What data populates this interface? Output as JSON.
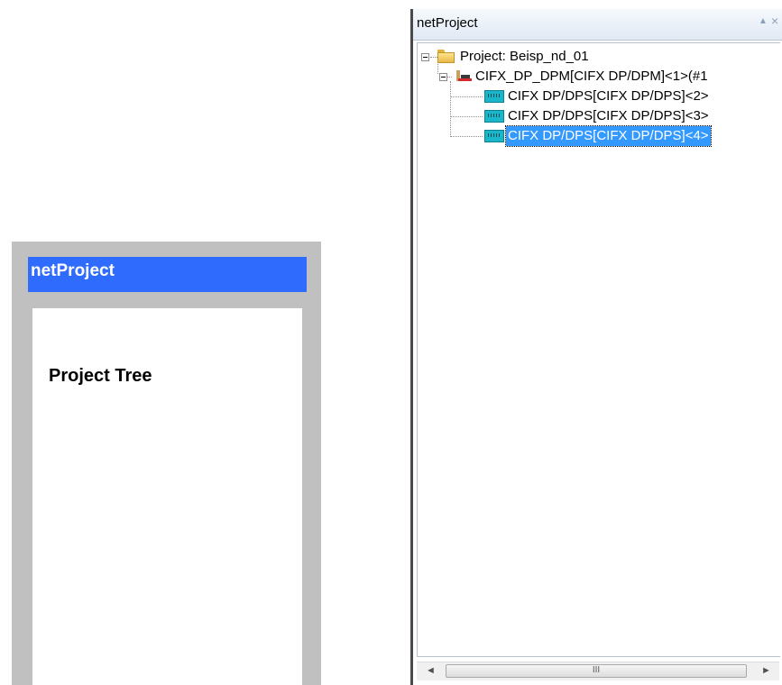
{
  "schematic": {
    "title": "netProject",
    "label": "Project Tree"
  },
  "pane": {
    "title": "netProject",
    "pin_icon": "▲",
    "close_icon": "×"
  },
  "tree": {
    "root": "Project: Beisp_nd_01",
    "master": "CIFX_DP_DPM[CIFX DP/DPM]<1>(#1",
    "slaves": [
      "CIFX DP/DPS[CIFX DP/DPS]<2>",
      "CIFX DP/DPS[CIFX DP/DPS]<3>",
      "CIFX DP/DPS[CIFX DP/DPS]<4>"
    ],
    "selected_index": 2
  },
  "scrollbar": {
    "left_arrow": "◄",
    "right_arrow": "►",
    "grip": "III"
  },
  "colors": {
    "schematic_title_bg": "#2f6bfd",
    "selection_bg": "#3399ff"
  }
}
